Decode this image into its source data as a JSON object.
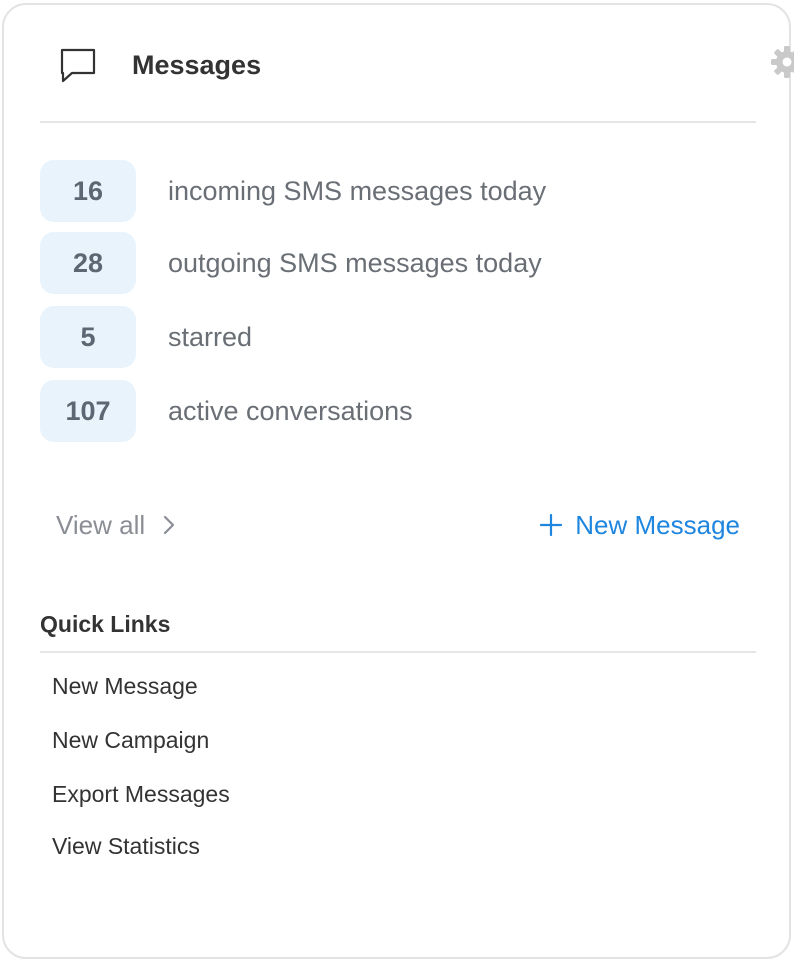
{
  "header": {
    "title": "Messages",
    "icons": {
      "title_icon": "chat-bubble-icon",
      "settings_icon": "gear-icon"
    }
  },
  "stats": [
    {
      "value": "16",
      "label": "incoming SMS messages today"
    },
    {
      "value": "28",
      "label": "outgoing SMS messages today"
    },
    {
      "value": "5",
      "label": "starred"
    },
    {
      "value": "107",
      "label": "active conversations"
    }
  ],
  "actions": {
    "view_all": "View all",
    "new_message": "New Message"
  },
  "quick_links": {
    "title": "Quick Links",
    "items": [
      "New Message",
      "New Campaign",
      "Export Messages",
      "View Statistics"
    ]
  },
  "colors": {
    "badge_bg": "#e9f3fb",
    "accent": "#1f86e0",
    "border": "#e3e3e3"
  }
}
